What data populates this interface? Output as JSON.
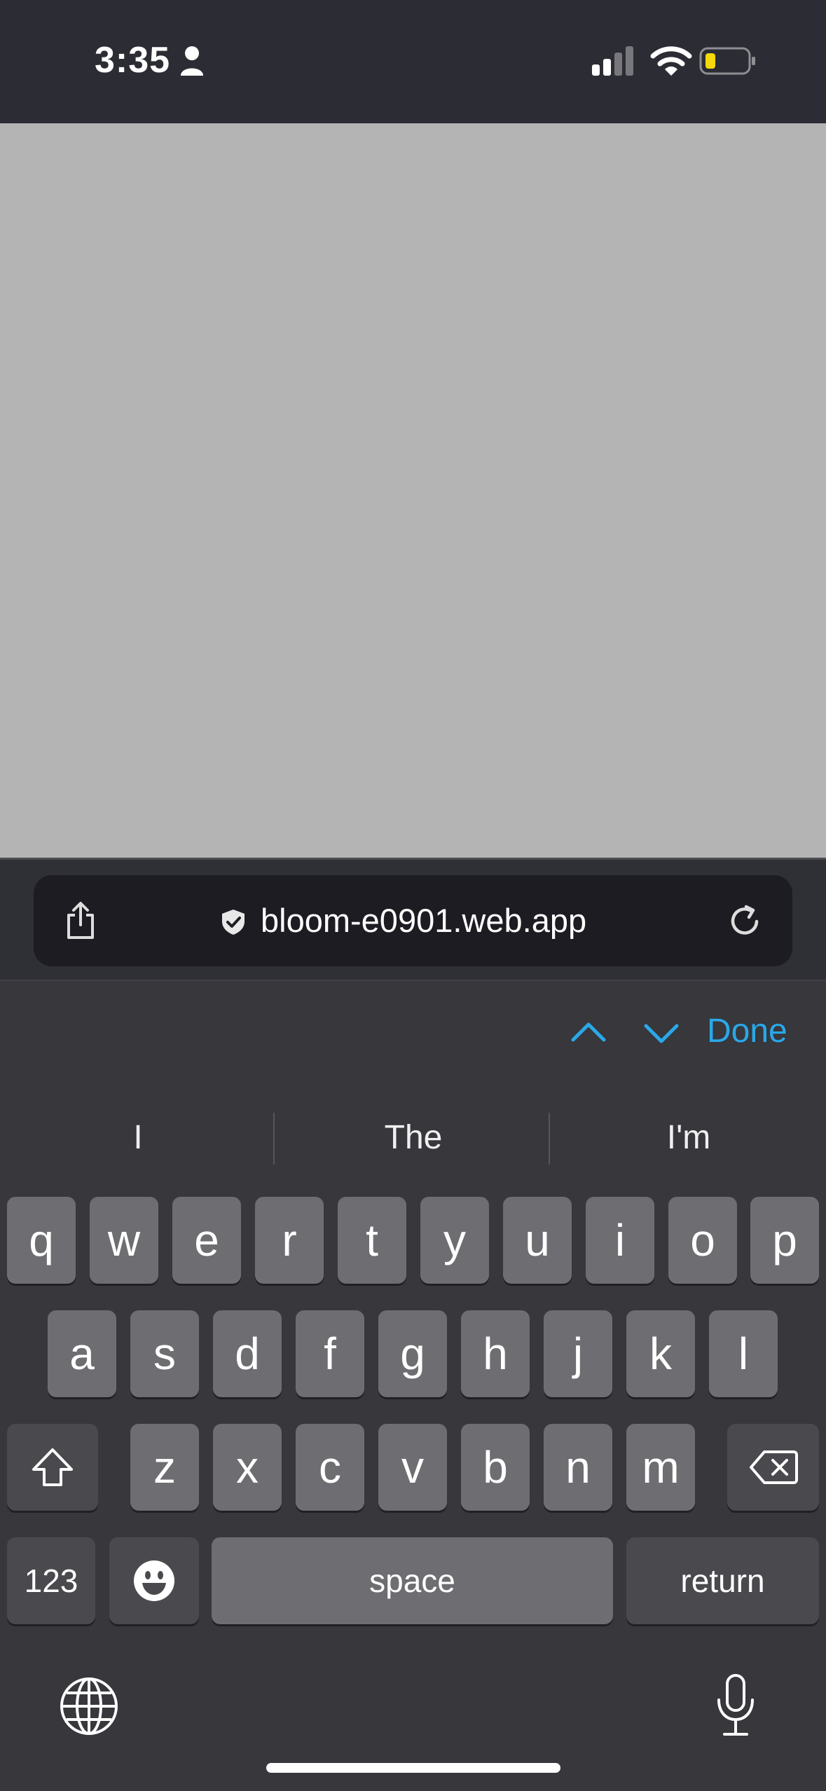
{
  "status_bar": {
    "time": "3:35"
  },
  "browser": {
    "url": "bloom-e0901.web.app"
  },
  "keyboard": {
    "accessory": {
      "done_label": "Done"
    },
    "suggestions": [
      "I",
      "The",
      "I'm"
    ],
    "rows": {
      "row1": [
        "q",
        "w",
        "e",
        "r",
        "t",
        "y",
        "u",
        "i",
        "o",
        "p"
      ],
      "row2": [
        "a",
        "s",
        "d",
        "f",
        "g",
        "h",
        "j",
        "k",
        "l"
      ],
      "row3": [
        "z",
        "x",
        "c",
        "v",
        "b",
        "n",
        "m"
      ]
    },
    "numbers_label": "123",
    "space_label": "space",
    "return_label": "return"
  },
  "colors": {
    "accent": "#2aa8e8",
    "battery_fill": "#f5d90a"
  }
}
